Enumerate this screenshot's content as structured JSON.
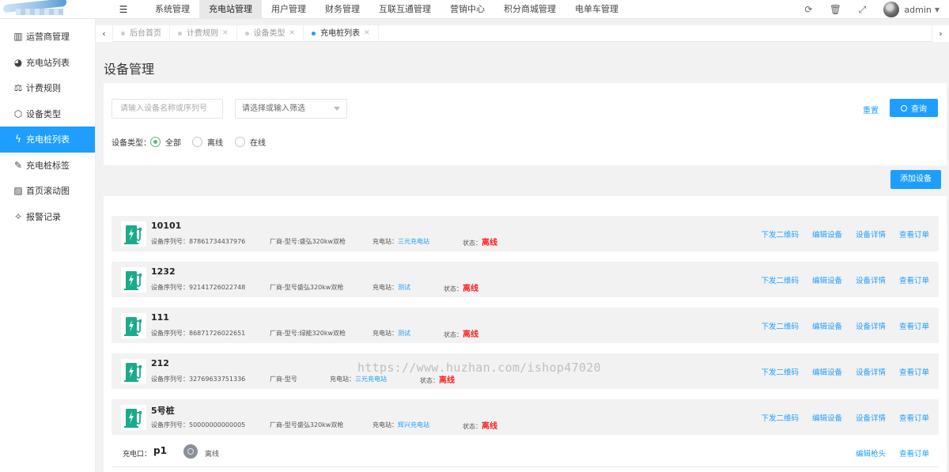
{
  "topbar": {
    "menu_toggle_icon": "menu-icon",
    "nav": [
      "系统管理",
      "充电站管理",
      "用户管理",
      "财务管理",
      "互联互通管理",
      "营销中心",
      "积分商城管理",
      "电单车管理"
    ],
    "active_nav": "充电站管理",
    "user_name": "admin"
  },
  "sidebar": {
    "items": [
      {
        "label": "运营商管理",
        "icon": "building-icon"
      },
      {
        "label": "充电站列表",
        "icon": "pie-chart-icon"
      },
      {
        "label": "计费规则",
        "icon": "scale-icon"
      },
      {
        "label": "设备类型",
        "icon": "hexagon-icon"
      },
      {
        "label": "充电桩列表",
        "icon": "lightning-icon",
        "active": true
      },
      {
        "label": "充电桩标签",
        "icon": "tag-icon"
      },
      {
        "label": "首页滚动图",
        "icon": "image-icon"
      },
      {
        "label": "报警记录",
        "icon": "alarm-icon"
      }
    ]
  },
  "tabs": [
    {
      "label": "后台首页",
      "closable": false
    },
    {
      "label": "计费规则",
      "closable": true
    },
    {
      "label": "设备类型",
      "closable": true
    },
    {
      "label": "充电桩列表",
      "closable": true,
      "active": true
    }
  ],
  "page_title": "设备管理",
  "filter": {
    "search_placeholder": "请输入设备名称或序列号",
    "select_placeholder": "请选择或输入筛选",
    "reset_label": "重置",
    "query_label": "查询",
    "type_label": "设备类型：",
    "options": [
      "全部",
      "离线",
      "在线"
    ],
    "selected_option": "全部"
  },
  "add_button_label": "添加设备",
  "devices": [
    {
      "name": "10101",
      "serial": "设备序列号：87861734437976",
      "model": "厂商-型号:盛弘320kw双枪",
      "station_label": "充电站：",
      "station": "三元充电站",
      "status_label": "状态：",
      "status": "离线"
    },
    {
      "name": "1232",
      "serial": "设备序列号：92141726022748",
      "model": "厂商-型号盛弘320kw双枪",
      "station_label": "充电站：",
      "station": "测试",
      "status_label": "状态：",
      "status": "离线"
    },
    {
      "name": "111",
      "serial": "设备序列号：86871726022651",
      "model": "厂商-型号:绿能320kw双枪",
      "station_label": "充电站：",
      "station": "测试",
      "status_label": "状态：",
      "status": "离线"
    },
    {
      "name": "212",
      "serial": "设备序列号：32769633751336",
      "model": "厂商-型号",
      "station_label": "充电站：",
      "station": "三元充电站",
      "status_label": "状态：",
      "status": "离线"
    },
    {
      "name": "5号桩",
      "serial": "设备序列号：50000000000005",
      "model": "厂商-型号盛弘320kw双枪",
      "station_label": "充电站：",
      "station": "辉兴充电站",
      "status_label": "状态：",
      "status": "离线"
    }
  ],
  "device_actions": [
    "下发二维码",
    "编辑设备",
    "设备详情",
    "查看订单"
  ],
  "port": {
    "label": "充电口：",
    "name": "p1",
    "status": "离线",
    "actions": [
      "编辑枪头",
      "查看订单"
    ]
  },
  "watermark": "https://www.huzhan.com/ishop47020",
  "colors": {
    "accent": "#1e9fff",
    "offline": "#ff2222",
    "radio_checked": "#5fb878",
    "device_icon": "#1aab8a"
  }
}
